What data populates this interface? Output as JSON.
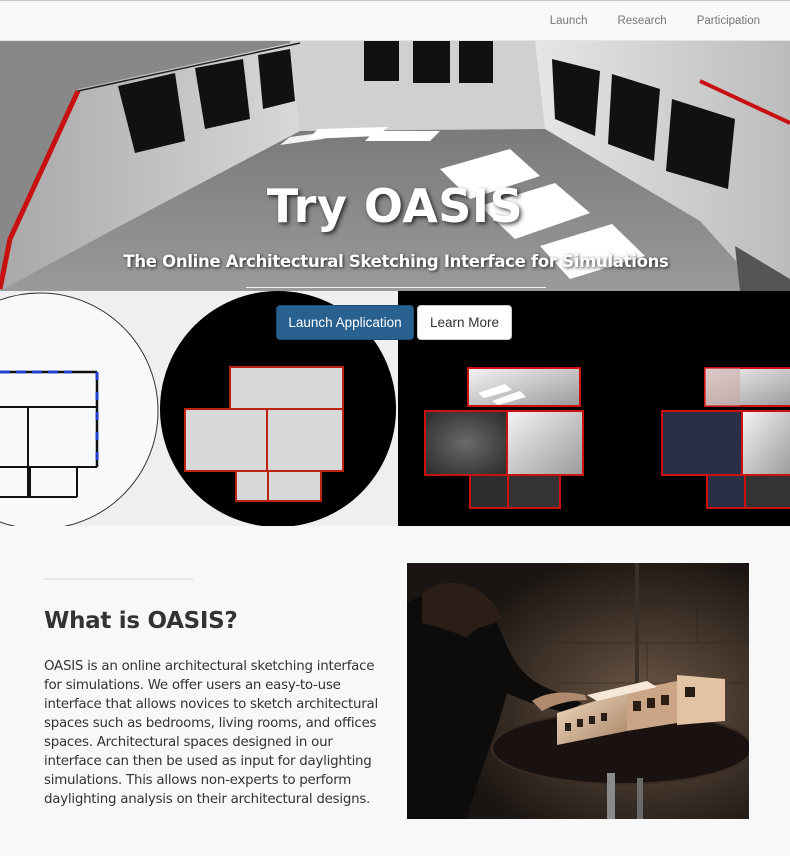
{
  "nav": {
    "links": [
      "Launch",
      "Research",
      "Participation"
    ]
  },
  "hero": {
    "title": "Try OASIS",
    "subtitle": "The Online Architectural Sketching Interface for Simulations",
    "primary_button": "Launch Application",
    "secondary_button": "Learn More"
  },
  "intro": {
    "heading": "What is OASIS?",
    "body": "OASIS is an online architectural sketching interface for simulations. We offer users an easy-to-use interface that allows novices to sketch architectural spaces such as bedrooms, living rooms, and offices spaces. Architectural spaces designed in our interface can then be used as input for daylighting simulations. This allows non-experts to perform daylighting analysis on their architectural designs."
  },
  "colors": {
    "primary": "#286090",
    "wall_red": "#cc1111",
    "nav_text": "#777777"
  }
}
